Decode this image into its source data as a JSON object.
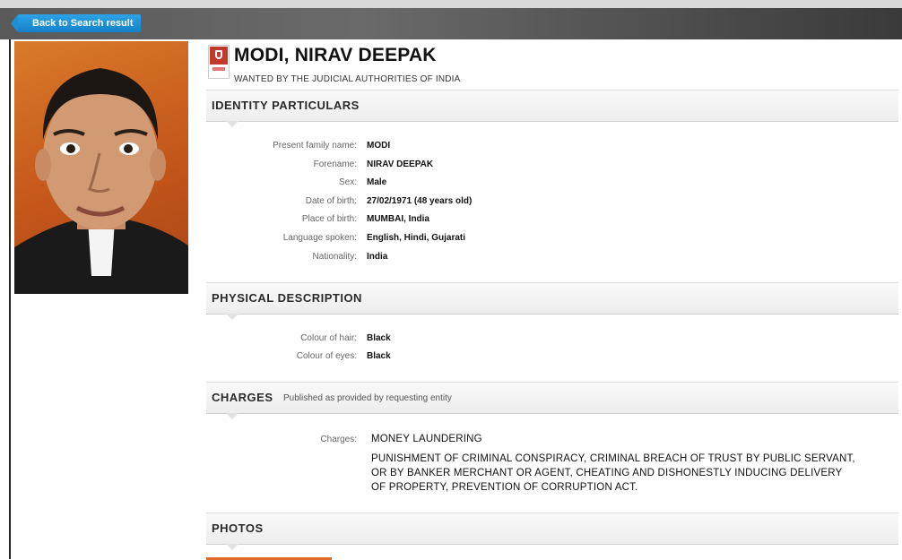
{
  "toolbar": {
    "back_label": "Back to Search result"
  },
  "profile": {
    "name": "MODI, NIRAV DEEPAK",
    "wanted_by": "WANTED BY THE JUDICIAL AUTHORITIES OF INDIA"
  },
  "identity": {
    "title": "IDENTITY PARTICULARS",
    "fields": [
      {
        "label": "Present family name:",
        "value": "MODI"
      },
      {
        "label": "Forename:",
        "value": "NIRAV DEEPAK"
      },
      {
        "label": "Sex:",
        "value": "Male"
      },
      {
        "label": "Date of birth:",
        "value": "27/02/1971 (48 years old)"
      },
      {
        "label": "Place of birth:",
        "value": "MUMBAI, India"
      },
      {
        "label": "Language spoken:",
        "value": "English, Hindi, Gujarati"
      },
      {
        "label": "Nationality:",
        "value": "India"
      }
    ]
  },
  "physical": {
    "title": "PHYSICAL DESCRIPTION",
    "fields": [
      {
        "label": "Colour of hair:",
        "value": "Black"
      },
      {
        "label": "Colour of eyes:",
        "value": "Black"
      }
    ]
  },
  "charges": {
    "title": "CHARGES",
    "subtitle": "Published as provided by requesting entity",
    "label": "Charges:",
    "items": [
      "MONEY LAUNDERING",
      "PUNISHMENT OF CRIMINAL CONSPIRACY, CRIMINAL BREACH OF TRUST BY PUBLIC SERVANT, OR BY BANKER MERCHANT OR AGENT, CHEATING AND DISHONESTLY INDUCING DELIVERY OF PROPERTY, PREVENTION OF CORRUPTION ACT."
    ]
  },
  "photos": {
    "title": "PHOTOS"
  },
  "colors": {
    "accent": "#1a8ad4",
    "header_dark": "#4a4a4a",
    "photo_bg": "#d06a24"
  },
  "icons": {
    "back": "arrow-left-icon",
    "badge": "interpol-emblem-icon"
  }
}
